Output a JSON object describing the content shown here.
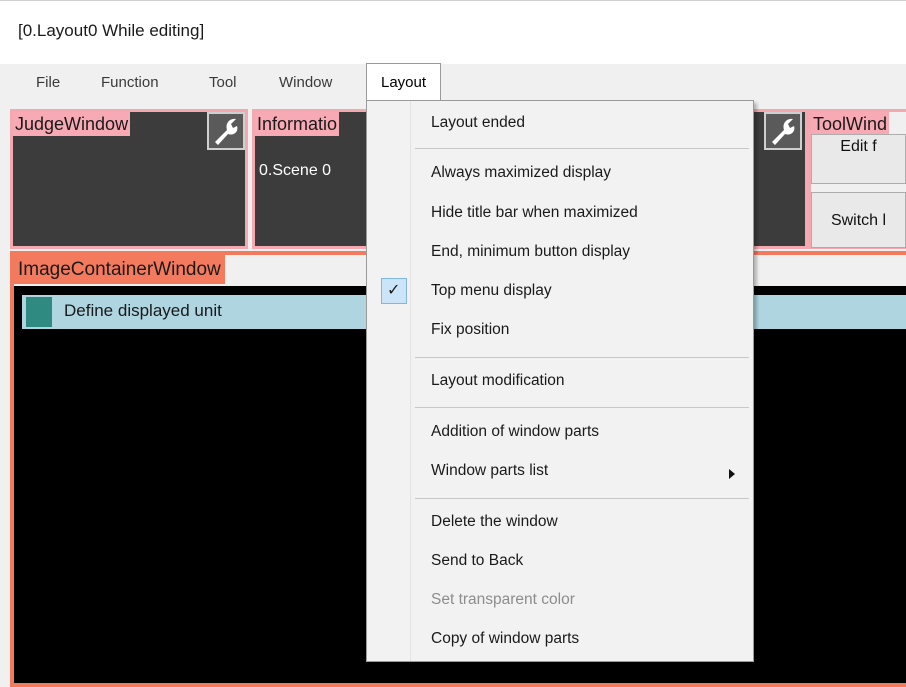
{
  "window": {
    "title": "[0.Layout0 While editing]"
  },
  "menubar": {
    "items": [
      "File",
      "Function",
      "Tool",
      "Window",
      "Layout"
    ]
  },
  "panels": {
    "judge": {
      "title": "JudgeWindow"
    },
    "information": {
      "title": "Informatio",
      "text": "0.Scene 0"
    },
    "tool": {
      "title": "ToolWind",
      "btn1": "Edit f",
      "btn2": "Switch l"
    }
  },
  "image_container": {
    "title": "ImageContainerWindow",
    "unit_label": "Define displayed unit"
  },
  "layout_menu": {
    "items": [
      "Layout ended",
      "Always maximized display",
      "Hide title bar when maximized",
      "End, minimum button display",
      "Top menu display",
      "Fix position",
      "Layout modification",
      "Addition of window parts",
      "Window parts list",
      "Delete the window",
      "Send to Back",
      "Set transparent color",
      "Copy of window parts"
    ],
    "check_glyph": "✓"
  },
  "colors": {
    "judge_border": "#f4a8b0",
    "image_container_accent": "#f47a5e",
    "unit_bar": "#aed5e0",
    "unit_swatch": "#2f8a82",
    "checked_highlight": "#cce4f7"
  }
}
